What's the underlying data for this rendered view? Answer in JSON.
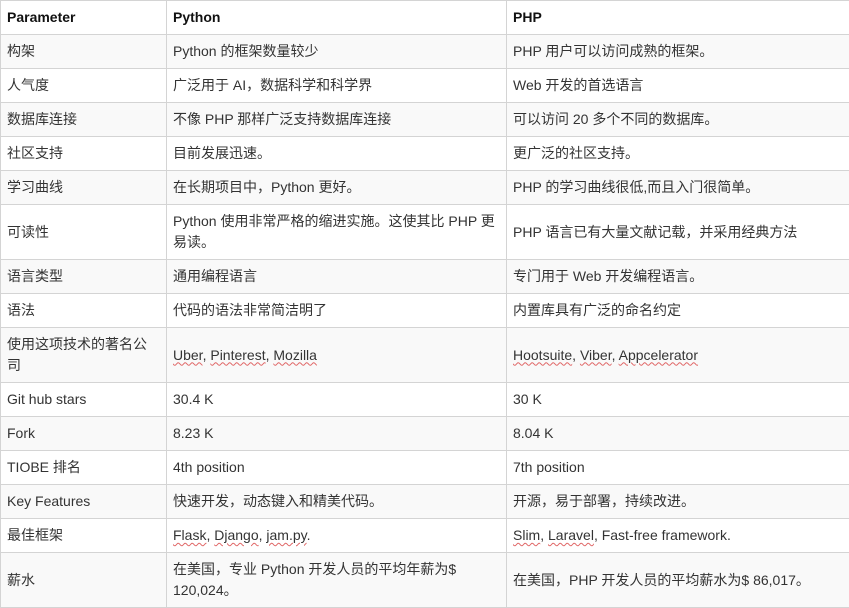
{
  "table": {
    "headers": [
      "Parameter",
      "Python",
      "PHP"
    ],
    "rows": [
      {
        "param": "构架",
        "python": [
          {
            "t": "Python 的框架数量较少"
          }
        ],
        "php": [
          {
            "t": "PHP 用户可以访问成熟的框架。"
          }
        ]
      },
      {
        "param": "人气度",
        "python": [
          {
            "t": "广泛用于 AI，数据科学和科学界"
          }
        ],
        "php": [
          {
            "t": "Web 开发的首选语言"
          }
        ]
      },
      {
        "param": "数据库连接",
        "python": [
          {
            "t": "不像 PHP 那样广泛支持数据库连接"
          }
        ],
        "php": [
          {
            "t": "可以访问 20 多个不同的数据库。"
          }
        ]
      },
      {
        "param": "社区支持",
        "python": [
          {
            "t": "目前发展迅速。"
          }
        ],
        "php": [
          {
            "t": "更广泛的社区支持。"
          }
        ]
      },
      {
        "param": "学习曲线",
        "python": [
          {
            "t": "在长期项目中，Python 更好。"
          }
        ],
        "php": [
          {
            "t": "PHP 的学习曲线很低,而且入门很简单。"
          }
        ]
      },
      {
        "param": "可读性",
        "python": [
          {
            "t": "Python 使用非常严格的缩进实施。这使其比 PHP 更易读。"
          }
        ],
        "php": [
          {
            "t": "PHP 语言已有大量文献记载，并采用经典方法"
          }
        ]
      },
      {
        "param": "语言类型",
        "python": [
          {
            "t": "通用编程语言"
          }
        ],
        "php": [
          {
            "t": "专门用于 Web 开发编程语言。"
          }
        ]
      },
      {
        "param": "语法",
        "python": [
          {
            "t": "代码的语法非常简洁明了"
          }
        ],
        "php": [
          {
            "t": "内置库具有广泛的命名约定"
          }
        ]
      },
      {
        "param": "使用这项技术的著名公司",
        "python": [
          {
            "t": "Uber",
            "typo": true
          },
          {
            "t": ", "
          },
          {
            "t": "Pinterest",
            "typo": true
          },
          {
            "t": ", "
          },
          {
            "t": "Mozilla",
            "typo": true
          }
        ],
        "php": [
          {
            "t": "Hootsuite",
            "typo": true
          },
          {
            "t": ", "
          },
          {
            "t": "Viber",
            "typo": true
          },
          {
            "t": ", "
          },
          {
            "t": "Appcelerator",
            "typo": true
          }
        ]
      },
      {
        "param": "Git hub stars",
        "python": [
          {
            "t": "30.4 K"
          }
        ],
        "php": [
          {
            "t": "30 K"
          }
        ]
      },
      {
        "param": "Fork",
        "python": [
          {
            "t": "8.23 K"
          }
        ],
        "php": [
          {
            "t": "8.04 K"
          }
        ]
      },
      {
        "param": "TIOBE 排名",
        "python": [
          {
            "t": "4th position"
          }
        ],
        "php": [
          {
            "t": "7th position"
          }
        ]
      },
      {
        "param": "Key Features",
        "python": [
          {
            "t": "快速开发，动态键入和精美代码。"
          }
        ],
        "php": [
          {
            "t": "开源，易于部署，持续改进。"
          }
        ]
      },
      {
        "param": "最佳框架",
        "python": [
          {
            "t": "Flask",
            "typo": true
          },
          {
            "t": ", "
          },
          {
            "t": "Django",
            "typo": true
          },
          {
            "t": ", "
          },
          {
            "t": "jam.py",
            "typo": true
          },
          {
            "t": "."
          }
        ],
        "php": [
          {
            "t": "Slim",
            "typo": true
          },
          {
            "t": ", "
          },
          {
            "t": "Laravel",
            "typo": true
          },
          {
            "t": ", Fast-free framework."
          }
        ]
      },
      {
        "param": "薪水",
        "python": [
          {
            "t": "在美国，专业 Python 开发人员的平均年薪为$ 120,024。"
          }
        ],
        "php": [
          {
            "t": "在美国，PHP 开发人员的平均薪水为$ 86,017。"
          }
        ]
      }
    ]
  }
}
